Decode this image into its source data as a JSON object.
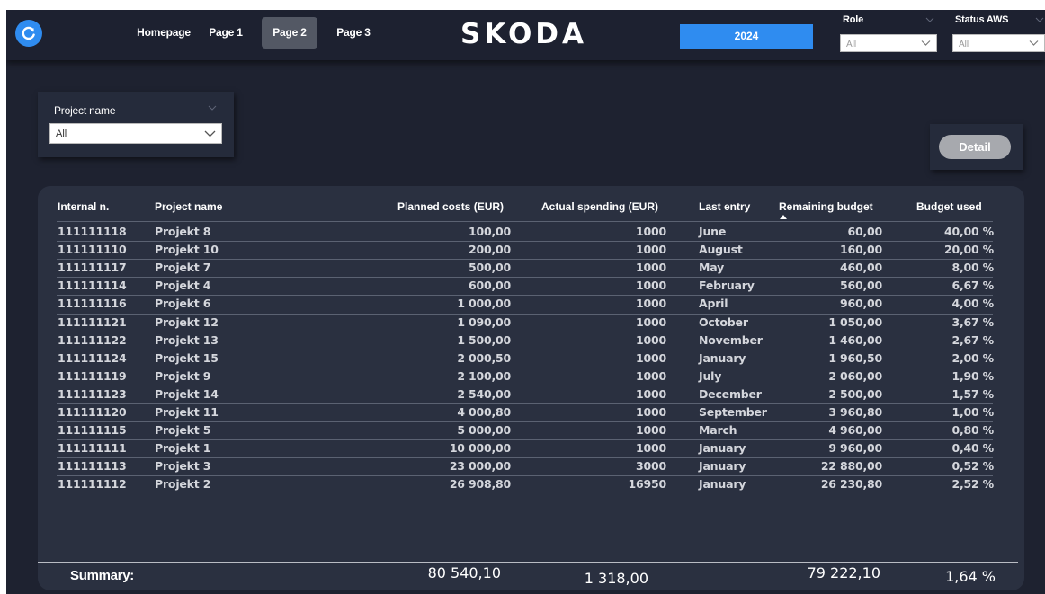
{
  "nav": {
    "items": [
      {
        "label": "Homepage",
        "active": false
      },
      {
        "label": "Page 1",
        "active": false
      },
      {
        "label": "Page 2",
        "active": true
      },
      {
        "label": "Page 3",
        "active": false
      }
    ]
  },
  "brand": {
    "logo": "SKODA"
  },
  "year_button": "2024",
  "filters": {
    "role": {
      "title": "Role",
      "value": "All"
    },
    "status_aws": {
      "title": "Status AWS",
      "value": "All"
    },
    "project_name": {
      "title": "Project name",
      "value": "All"
    }
  },
  "detail_button": "Detail",
  "table": {
    "columns": [
      "Internal n.",
      "Project name",
      "Planned costs (EUR)",
      "Actual spending (EUR)",
      "Last entry",
      "Remaining budget",
      "Budget used"
    ],
    "sorted_column": "Remaining budget",
    "rows": [
      [
        "111111118",
        "Projekt 8",
        "100,00",
        "1000",
        "June",
        "60,00",
        "40,00 %"
      ],
      [
        "111111110",
        "Projekt 10",
        "200,00",
        "1000",
        "August",
        "160,00",
        "20,00 %"
      ],
      [
        "111111117",
        "Projekt 7",
        "500,00",
        "1000",
        "May",
        "460,00",
        "8,00 %"
      ],
      [
        "111111114",
        "Projekt 4",
        "600,00",
        "1000",
        "February",
        "560,00",
        "6,67 %"
      ],
      [
        "111111116",
        "Projekt 6",
        "1 000,00",
        "1000",
        "April",
        "960,00",
        "4,00 %"
      ],
      [
        "111111121",
        "Projekt 12",
        "1 090,00",
        "1000",
        "October",
        "1 050,00",
        "3,67 %"
      ],
      [
        "111111122",
        "Projekt 13",
        "1 500,00",
        "1000",
        "November",
        "1 460,00",
        "2,67 %"
      ],
      [
        "111111124",
        "Projekt 15",
        "2 000,50",
        "1000",
        "January",
        "1 960,50",
        "2,00 %"
      ],
      [
        "111111119",
        "Projekt 9",
        "2 100,00",
        "1000",
        "July",
        "2 060,00",
        "1,90 %"
      ],
      [
        "111111123",
        "Projekt 14",
        "2 540,00",
        "1000",
        "December",
        "2 500,00",
        "1,57 %"
      ],
      [
        "111111120",
        "Projekt 11",
        "4 000,80",
        "1000",
        "September",
        "3 960,80",
        "1,00 %"
      ],
      [
        "111111115",
        "Projekt 5",
        "5 000,00",
        "1000",
        "March",
        "4 960,00",
        "0,80 %"
      ],
      [
        "111111111",
        "Projekt 1",
        "10 000,00",
        "1000",
        "January",
        "9 960,00",
        "0,40 %"
      ],
      [
        "111111113",
        "Projekt 3",
        "23 000,00",
        "3000",
        "January",
        "22 880,00",
        "0,52 %"
      ],
      [
        "111111112",
        "Projekt 2",
        "26 908,80",
        "16950",
        "January",
        "26 230,80",
        "2,52 %"
      ]
    ],
    "summary": {
      "label": "Summary:",
      "planned": "80 540,10",
      "actual": "1 318,00",
      "remaining": "79 222,10",
      "used": "1,64 %"
    }
  },
  "colors": {
    "background": "#1e2230",
    "card": "#2a3040",
    "accent_blue": "#2f8cf0",
    "active_tab": "#535864"
  }
}
